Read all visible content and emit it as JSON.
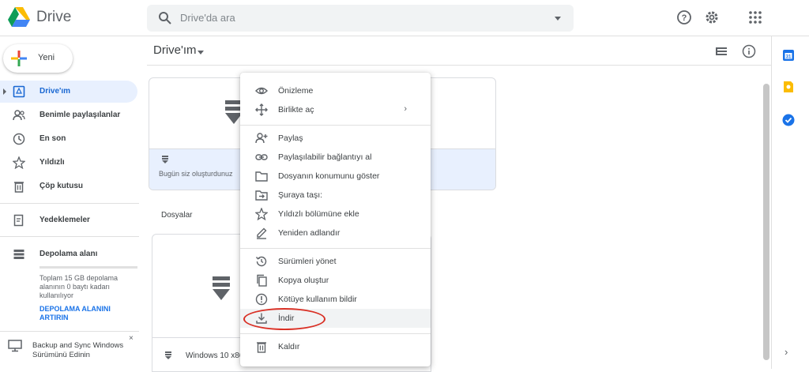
{
  "app": {
    "name": "Drive"
  },
  "search": {
    "placeholder": "Drive'da ara"
  },
  "header_icons": [
    "help-icon",
    "settings-icon",
    "apps-grid-icon"
  ],
  "sidebar": {
    "new_label": "Yeni",
    "items": [
      {
        "label": "Drive'ım",
        "icon": "my-drive-icon",
        "active": true
      },
      {
        "label": "Benimle paylaşılanlar",
        "icon": "shared-icon"
      },
      {
        "label": "En son",
        "icon": "clock-icon"
      },
      {
        "label": "Yıldızlı",
        "icon": "star-icon"
      },
      {
        "label": "Çöp kutusu",
        "icon": "trash-icon"
      },
      {
        "label": "Yedeklemeler",
        "icon": "backup-icon"
      },
      {
        "label": "Depolama alanı",
        "icon": "storage-icon"
      }
    ],
    "storage_info": "Toplam 15 GB depolama alanının 0 baytı kadarı kullanılıyor",
    "storage_link": "DEPOLAMA ALANINI ARTIRIN",
    "backup_promo": "Backup and Sync Windows Sürümünü Edinin",
    "backup_close": "×"
  },
  "main": {
    "title": "Drive'ım",
    "quick_card_caption": "Bugün siz oluşturdunuz",
    "files_label": "Dosyalar",
    "file_name": "Windows 10 x86"
  },
  "context_menu": {
    "items": [
      {
        "label": "Önizleme",
        "icon": "eye-icon"
      },
      {
        "label": "Birlikte aç",
        "icon": "open-with-icon",
        "arrow": "›"
      },
      {
        "label": "Paylaş",
        "icon": "share-person-icon"
      },
      {
        "label": "Paylaşılabilir bağlantıyı al",
        "icon": "link-icon"
      },
      {
        "label": "Dosyanın konumunu göster",
        "icon": "folder-icon"
      },
      {
        "label": "Şuraya taşı:",
        "icon": "move-to-icon"
      },
      {
        "label": "Yıldızlı bölümüne ekle",
        "icon": "star-outline-icon"
      },
      {
        "label": "Yeniden adlandır",
        "icon": "pencil-icon"
      },
      {
        "label": "Sürümleri yönet",
        "icon": "history-icon"
      },
      {
        "label": "Kopya oluştur",
        "icon": "copy-icon"
      },
      {
        "label": "Kötüye kullanım bildir",
        "icon": "report-icon"
      },
      {
        "label": "İndir",
        "icon": "download-icon",
        "highlighted": true
      },
      {
        "label": "Kaldır",
        "icon": "trash-icon"
      }
    ]
  },
  "colors": {
    "accent": "#1967d2",
    "active_bg": "#e8f0fe",
    "highlight_oval": "#d93025"
  }
}
